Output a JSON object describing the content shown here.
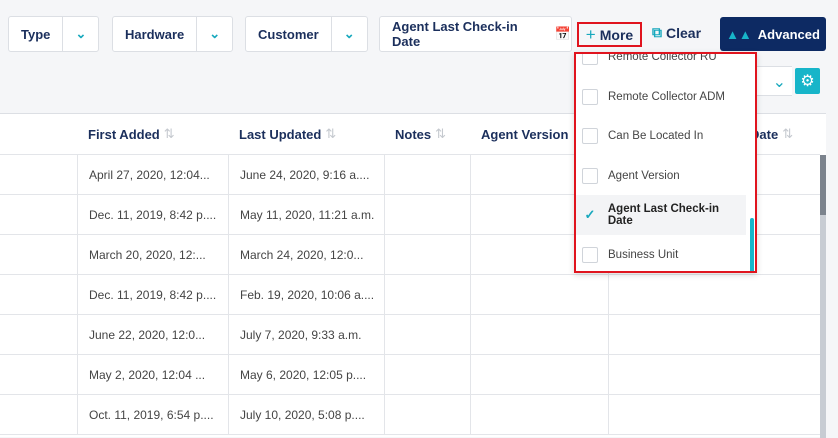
{
  "filters": [
    {
      "label": "Type"
    },
    {
      "label": "Hardware"
    },
    {
      "label": "Customer"
    }
  ],
  "date_filter": {
    "label": "Agent Last Check-in Date",
    "icon": "calendar-icon"
  },
  "more_label": "More",
  "clear_label": "Clear",
  "advanced_label": "Advanced",
  "columns": [
    "First Added",
    "Last Updated",
    "Notes",
    "Agent Version",
    "Date"
  ],
  "rows": [
    [
      "April 27, 2020, 12:04...",
      "June 24, 2020, 9:16 a...."
    ],
    [
      "Dec. 11, 2019, 8:42 p....",
      "May 11, 2020, 11:21 a.m."
    ],
    [
      "March 20, 2020, 12:...",
      "March 24, 2020, 12:0..."
    ],
    [
      "Dec. 11, 2019, 8:42 p....",
      "Feb. 19, 2020, 10:06 a...."
    ],
    [
      "June 22, 2020, 12:0...",
      "July 7, 2020, 9:33 a.m."
    ],
    [
      "May 2, 2020, 12:04 ...",
      "May 6, 2020, 12:05 p...."
    ],
    [
      "Oct. 11, 2019, 6:54 p....",
      "July 10, 2020, 5:08 p...."
    ]
  ],
  "more_menu": [
    {
      "label": "Remote Collector RU",
      "checked": false
    },
    {
      "label": "Remote Collector ADM",
      "checked": false
    },
    {
      "label": "Can Be Located In",
      "checked": false
    },
    {
      "label": "Agent Version",
      "checked": false
    },
    {
      "label": "Agent Last Check-in Date",
      "checked": true
    },
    {
      "label": "Business Unit",
      "checked": false
    }
  ],
  "colors": {
    "accent": "#17b5c9",
    "navy": "#0d2a63",
    "highlight": "#e0141e"
  }
}
